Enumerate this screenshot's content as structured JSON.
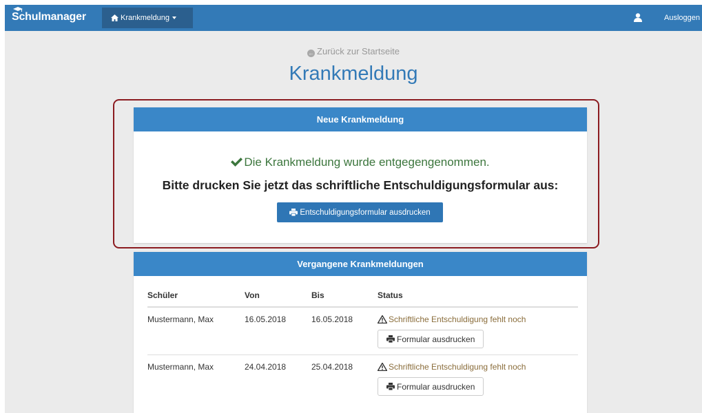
{
  "navbar": {
    "brand": "Schulmanager",
    "menu_label": "Krankmeldung",
    "logout": "Ausloggen"
  },
  "back_link": "Zurück zur Startseite",
  "page_title": "Krankmeldung",
  "new_panel": {
    "heading": "Neue Krankmeldung",
    "success_text": "Die Krankmeldung wurde entgegengenommen.",
    "instruction": "Bitte drucken Sie jetzt das schriftliche Entschuldigungsformular aus:",
    "print_button": "Entschuldigungsformular ausdrucken"
  },
  "past_panel": {
    "heading": "Vergangene Krankmeldungen",
    "columns": [
      "Schüler",
      "Von",
      "Bis",
      "Status"
    ],
    "rows": [
      {
        "last_name": "Mustermann",
        "first_name": ", Max",
        "von": "16.05.2018",
        "bis": "16.05.2018",
        "status": "Schriftliche Entschuldigung fehlt noch",
        "button": "Formular ausdrucken"
      },
      {
        "last_name": "Mustermann",
        "first_name": ", Max",
        "von": "24.04.2018",
        "bis": "25.04.2018",
        "status": "Schriftliche Entschuldigung fehlt noch",
        "button": "Formular ausdrucken"
      }
    ]
  },
  "colors": {
    "navbar": "#337ab7",
    "panel_heading": "#3a87c8",
    "success": "#3c763d",
    "warning": "#8a6d3b",
    "highlight_frame": "#8b1a1f"
  }
}
